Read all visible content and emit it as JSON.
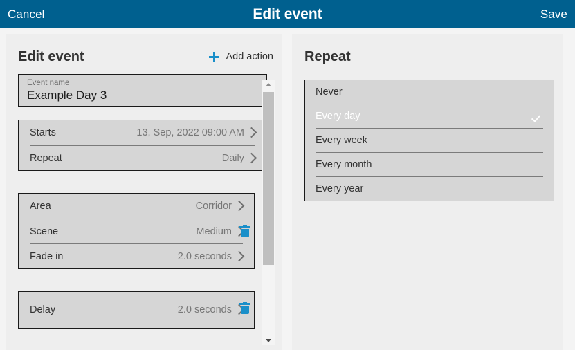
{
  "topbar": {
    "cancel_label": "Cancel",
    "title": "Edit event",
    "save_label": "Save",
    "background_color": "#00608f"
  },
  "left_panel": {
    "title": "Edit event",
    "add_action_label": "Add action",
    "add_action_icon": "plus-icon",
    "accent_color": "#1a8fc9",
    "event_name_field": {
      "label": "Event name",
      "value": "Example Day 3"
    },
    "schedule_card": {
      "rows": [
        {
          "label": "Starts",
          "value": "13, Sep, 2022  09:00 AM",
          "chevron": true
        },
        {
          "label": "Repeat",
          "value": "Daily",
          "chevron": true
        }
      ]
    },
    "action_cards": [
      {
        "delete_icon": "trash-icon",
        "rows": [
          {
            "label": "Area",
            "value": "Corridor",
            "chevron": true
          },
          {
            "label": "Scene",
            "value": "Medium",
            "chevron": true
          },
          {
            "label": "Fade in",
            "value": "2.0 seconds",
            "chevron": true
          }
        ]
      },
      {
        "delete_icon": "trash-icon",
        "rows": [
          {
            "label": "Delay",
            "value": "2.0 seconds",
            "chevron": true
          }
        ]
      }
    ],
    "scrollbar": {
      "up_icon": "chevron-up-icon",
      "down_icon": "chevron-down-icon"
    }
  },
  "right_panel": {
    "title": "Repeat",
    "options": [
      {
        "label": "Never",
        "selected": false
      },
      {
        "label": "Every day",
        "selected": true
      },
      {
        "label": "Every week",
        "selected": false
      },
      {
        "label": "Every month",
        "selected": false
      },
      {
        "label": "Every year",
        "selected": false
      }
    ],
    "selected_check_icon": "check-icon"
  }
}
